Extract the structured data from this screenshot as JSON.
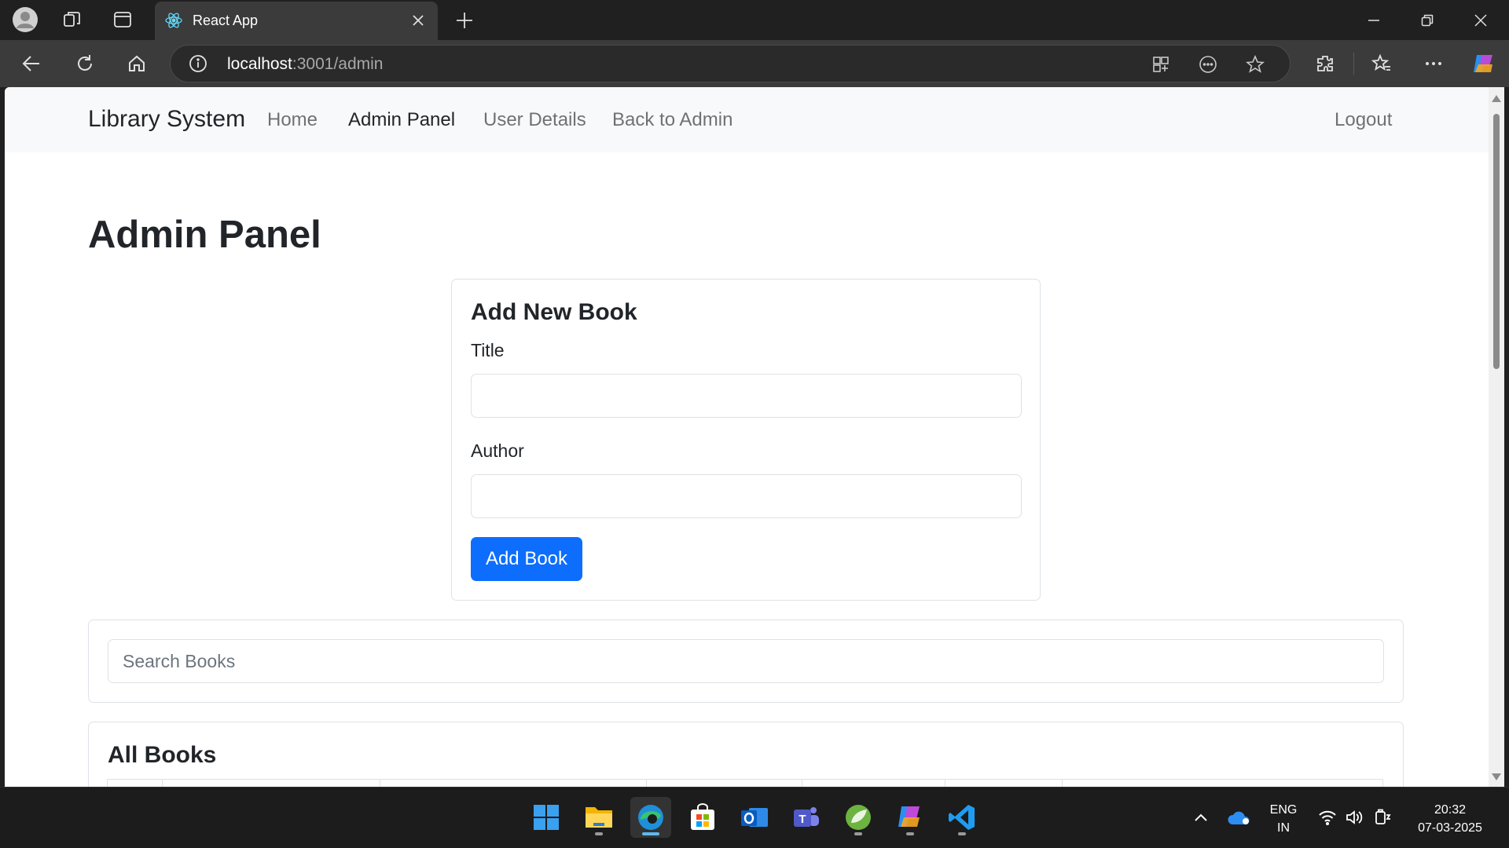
{
  "browser": {
    "tab_title": "React App",
    "address_host": "localhost",
    "address_rest": ":3001/admin"
  },
  "navbar": {
    "brand": "Library System",
    "links": [
      {
        "label": "Home",
        "active": false
      },
      {
        "label": "Admin Panel",
        "active": true
      },
      {
        "label": "User Details",
        "active": false
      },
      {
        "label": "Back to Admin",
        "active": false
      }
    ],
    "logout": "Logout"
  },
  "page": {
    "title": "Admin Panel"
  },
  "add_book": {
    "heading": "Add New Book",
    "title_label": "Title",
    "title_value": "",
    "author_label": "Author",
    "author_value": "",
    "submit_label": "Add Book"
  },
  "search": {
    "placeholder": "Search Books",
    "value": ""
  },
  "all_books": {
    "heading": "All Books"
  },
  "taskbar": {
    "language": "ENG",
    "region": "IN",
    "time": "20:32",
    "date": "07-03-2025"
  },
  "colors": {
    "primary": "#0d6efd",
    "navbar_bg": "#f8f9fa",
    "chrome_dark": "#202020",
    "chrome_toolbar": "#3b3b3b"
  }
}
